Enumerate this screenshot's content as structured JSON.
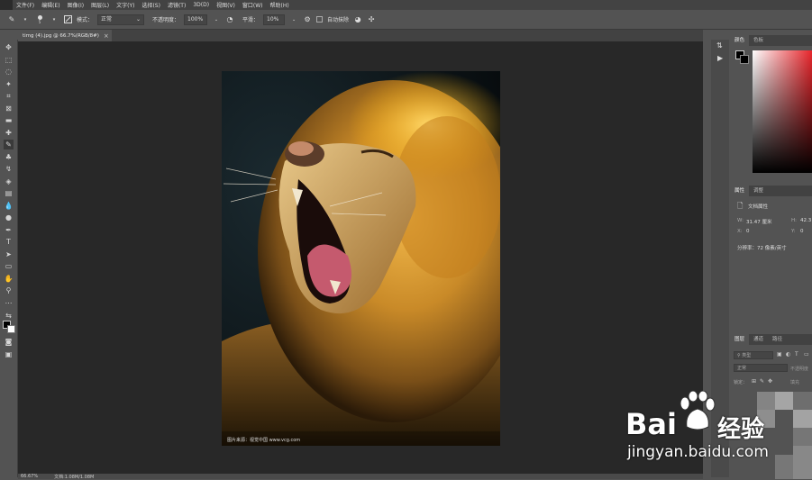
{
  "menubar": {
    "items": [
      "文件(F)",
      "编辑(E)",
      "图像(I)",
      "图层(L)",
      "文字(Y)",
      "选择(S)",
      "滤镜(T)",
      "3D(D)",
      "视图(V)",
      "窗口(W)",
      "帮助(H)"
    ]
  },
  "options": {
    "brush_size": "5",
    "mode_label": "模式：",
    "mode_value": "正常",
    "opacity_label": "不透明度：",
    "opacity_value": "100%",
    "smooth_label": "平滑：",
    "smooth_value": "10%",
    "auto_erase_label": "自动抹除"
  },
  "document": {
    "tab_title": "timg (4).jpg @ 66.7%(RGB/8#)",
    "close_glyph": "×",
    "photo_credit": "图片来源：视觉中国 www.vcg.com"
  },
  "status": {
    "zoom": "66.67%",
    "doc_size": "文档:1.08M/1.08M"
  },
  "panels": {
    "color_tabs": [
      "颜色",
      "色板"
    ],
    "props_tabs": [
      "属性",
      "调整"
    ],
    "doc_props_title": "文档属性",
    "w_label": "W:",
    "w_value": "31.47 厘米",
    "h_label": "H:",
    "h_value": "42.3",
    "x_label": "X:",
    "x_value": "0",
    "y_label": "Y:",
    "y_value": "0",
    "resolution": "分辨率：72 像素/英寸",
    "layers_tabs": [
      "图层",
      "通道",
      "路径"
    ],
    "layer_kind": "类型",
    "blend_mode": "正常",
    "opacity_label": "不透明度",
    "lock_label": "锁定：",
    "fill_label": "填充"
  },
  "watermark": {
    "brand_left": "Bai",
    "brand_right": "经验",
    "url": "jingyan.baidu.com"
  },
  "colors": {
    "canvas_bg": "#282828",
    "panel_bg": "#535353",
    "menubar_bg": "#434343"
  }
}
